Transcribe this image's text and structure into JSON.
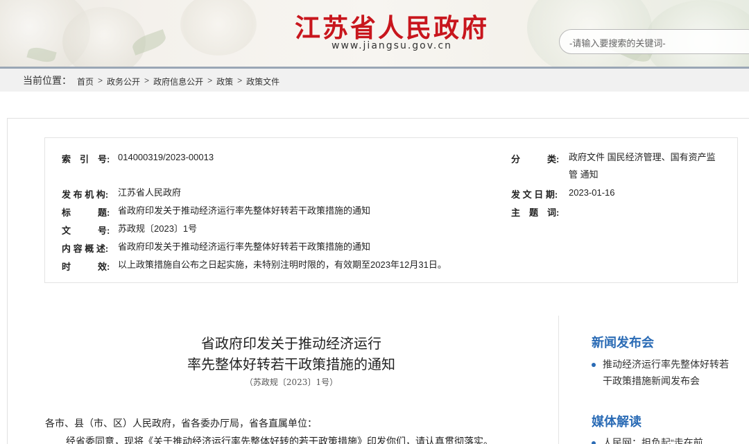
{
  "header": {
    "site_title": "江苏省人民政府",
    "site_domain": "www.jiangsu.gov.cn",
    "search_placeholder": "-请输入要搜索的关键词-"
  },
  "breadcrumb": {
    "label": "当前位置：",
    "items": [
      "首页",
      "政务公开",
      "政府信息公开",
      "政策",
      "政策文件"
    ],
    "separator": ">"
  },
  "meta": {
    "index_key": "索　引　号:",
    "index_val": "014000319/2023-00013",
    "category_key": "分　　　类:",
    "category_val_1": "政府文件 国民经济管理、国有资产监",
    "category_val_2": "管 通知",
    "issuer_key": "发 布 机 构:",
    "issuer_val": "江苏省人民政府",
    "date_key": "发 文 日 期:",
    "date_val": "2023-01-16",
    "title_key": "标　　　题:",
    "title_val": "省政府印发关于推动经济运行率先整体好转若干政策措施的通知",
    "subject_key": "主　题　词:",
    "subject_val": "",
    "docno_key": "文　　　号:",
    "docno_val": "苏政规〔2023〕1号",
    "summary_key": "内 容 概 述:",
    "summary_val": "省政府印发关于推动经济运行率先整体好转若干政策措施的通知",
    "validity_key": "时　　　效:",
    "validity_val": "以上政策措施自公布之日起实施，未特别注明时限的，有效期至2023年12月31日。"
  },
  "document": {
    "title_line1": "省政府印发关于推动经济运行",
    "title_line2": "率先整体好转若干政策措施的通知",
    "number": "（苏政规〔2023〕1号）",
    "salutation": "各市、县（市、区）人民政府，省各委办厅局，省各直属单位：",
    "para1": "经省委同意，现将《关于推动经济运行率先整体好转的若干政策措施》印发你们，请认真贯彻落实。"
  },
  "sidebar": {
    "news_heading": "新闻发布会",
    "news_item": "推动经济运行率先整体好转若干政策措施新闻发布会",
    "media_heading": "媒体解读",
    "media_item": "人民网：担负起“走在前"
  },
  "colors": {
    "title_red": "#c8161d",
    "link_blue": "#2a6bb5"
  }
}
